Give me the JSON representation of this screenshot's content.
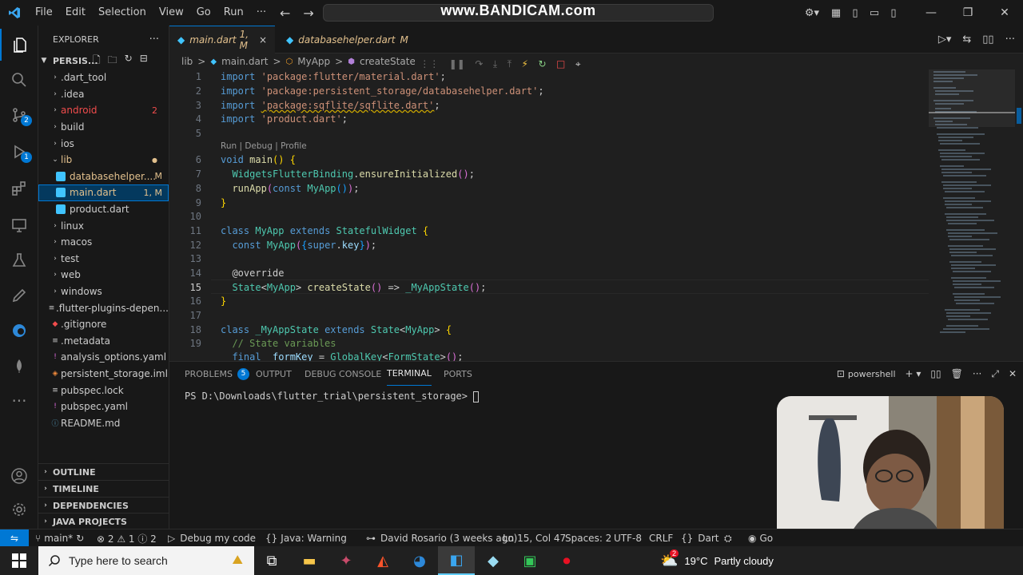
{
  "titlebar": {
    "menu": [
      "File",
      "Edit",
      "Selection",
      "View",
      "Go",
      "Run",
      "···"
    ],
    "watermark": "www.BANDICAM.com"
  },
  "activity": {
    "scm_badge": "2",
    "debug_badge": "1"
  },
  "explorer": {
    "title": "EXPLORER",
    "more": "···",
    "project": "PERSIS...",
    "items": [
      {
        "label": ".dart_tool",
        "badge": ""
      },
      {
        "label": ".idea",
        "badge": ""
      },
      {
        "label": "android",
        "badge": "2"
      },
      {
        "label": "build",
        "badge": ""
      },
      {
        "label": "ios",
        "badge": ""
      },
      {
        "label": "lib",
        "badge": "●"
      },
      {
        "label": "databasehelper....",
        "badge": "M"
      },
      {
        "label": "main.dart",
        "badge": "1, M"
      },
      {
        "label": "product.dart",
        "badge": ""
      },
      {
        "label": "linux",
        "badge": ""
      },
      {
        "label": "macos",
        "badge": ""
      },
      {
        "label": "test",
        "badge": ""
      },
      {
        "label": "web",
        "badge": ""
      },
      {
        "label": "windows",
        "badge": ""
      },
      {
        "label": ".flutter-plugins-depen...",
        "badge": ""
      },
      {
        "label": ".gitignore",
        "badge": ""
      },
      {
        "label": ".metadata",
        "badge": ""
      },
      {
        "label": "analysis_options.yaml",
        "badge": ""
      },
      {
        "label": "persistent_storage.iml",
        "badge": ""
      },
      {
        "label": "pubspec.lock",
        "badge": ""
      },
      {
        "label": "pubspec.yaml",
        "badge": ""
      },
      {
        "label": "README.md",
        "badge": ""
      }
    ],
    "sections": [
      "OUTLINE",
      "TIMELINE",
      "DEPENDENCIES",
      "JAVA PROJECTS"
    ]
  },
  "tabs": [
    {
      "label": "main.dart",
      "status": "1, M",
      "close": "×"
    },
    {
      "label": "databasehelper.dart",
      "status": "M"
    }
  ],
  "breadcrumb": [
    "lib",
    ">",
    "main.dart",
    ">",
    "MyApp",
    ">",
    "createState"
  ],
  "editor": {
    "codelens": "Run | Debug | Profile",
    "lines": [
      "1",
      "2",
      "3",
      "4",
      "5",
      "6",
      "7",
      "8",
      "9",
      "10",
      "11",
      "12",
      "13",
      "14",
      "15",
      "16",
      "17",
      "18",
      "19"
    ],
    "current_line": "15"
  },
  "panel": {
    "tabs": [
      "PROBLEMS",
      "OUTPUT",
      "DEBUG CONSOLE",
      "TERMINAL",
      "PORTS"
    ],
    "problems_badge": "5",
    "shell": "powershell",
    "prompt": "PS D:\\Downloads\\flutter_trial\\persistent_storage> "
  },
  "statusbar": {
    "branch": "main*",
    "errors": "⊗ 2 ⚠ 1 ⓘ 2",
    "debug": "Debug my code",
    "java": "Java: Warning",
    "blame": "David Rosario (3 weeks ago)",
    "position": "Ln 15, Col 47",
    "spaces": "Spaces: 2",
    "encoding": "UTF-8",
    "eol": "CRLF",
    "language": "Dart",
    "golive": "Go"
  },
  "taskbar": {
    "search_placeholder": "Type here to search",
    "temperature": "19°C",
    "weather": "Partly cloudy",
    "weather_badge": "2"
  },
  "colors": {
    "accent": "#0078d4",
    "keyword": "#569cd6",
    "string": "#ce9178",
    "class": "#4ec9b0",
    "function": "#dcdcaa",
    "comment": "#6a9955",
    "modified": "#e2c08d",
    "error": "#f14c4c"
  }
}
